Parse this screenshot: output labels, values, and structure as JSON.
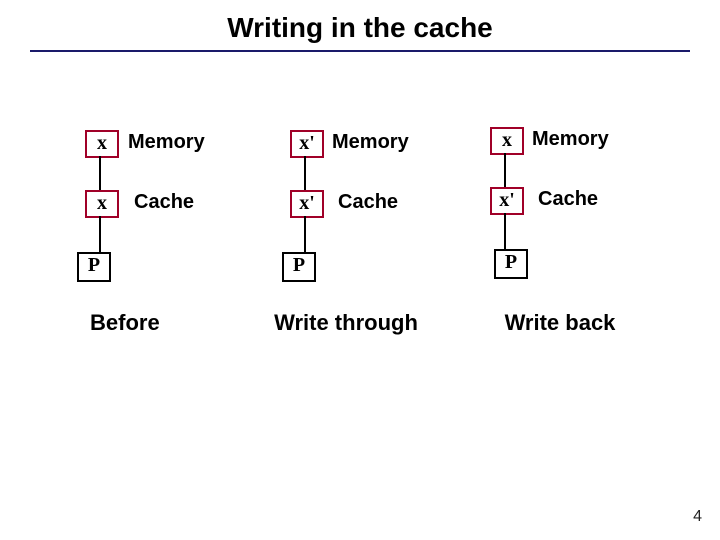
{
  "title": "Writing in the cache",
  "columns": [
    {
      "mem_val": "x",
      "cache_val": "x",
      "mem_label": "Memory",
      "cache_label": "Cache",
      "p_label": "P",
      "caption": "Before"
    },
    {
      "mem_val": "x'",
      "cache_val": "x'",
      "mem_label": "Memory",
      "cache_label": "Cache",
      "p_label": "P",
      "caption": "Write through"
    },
    {
      "mem_val": "x",
      "cache_val": "x'",
      "mem_label": "Memory",
      "cache_label": "Cache",
      "p_label": "P",
      "caption": "Write back"
    }
  ],
  "page_number": "4"
}
